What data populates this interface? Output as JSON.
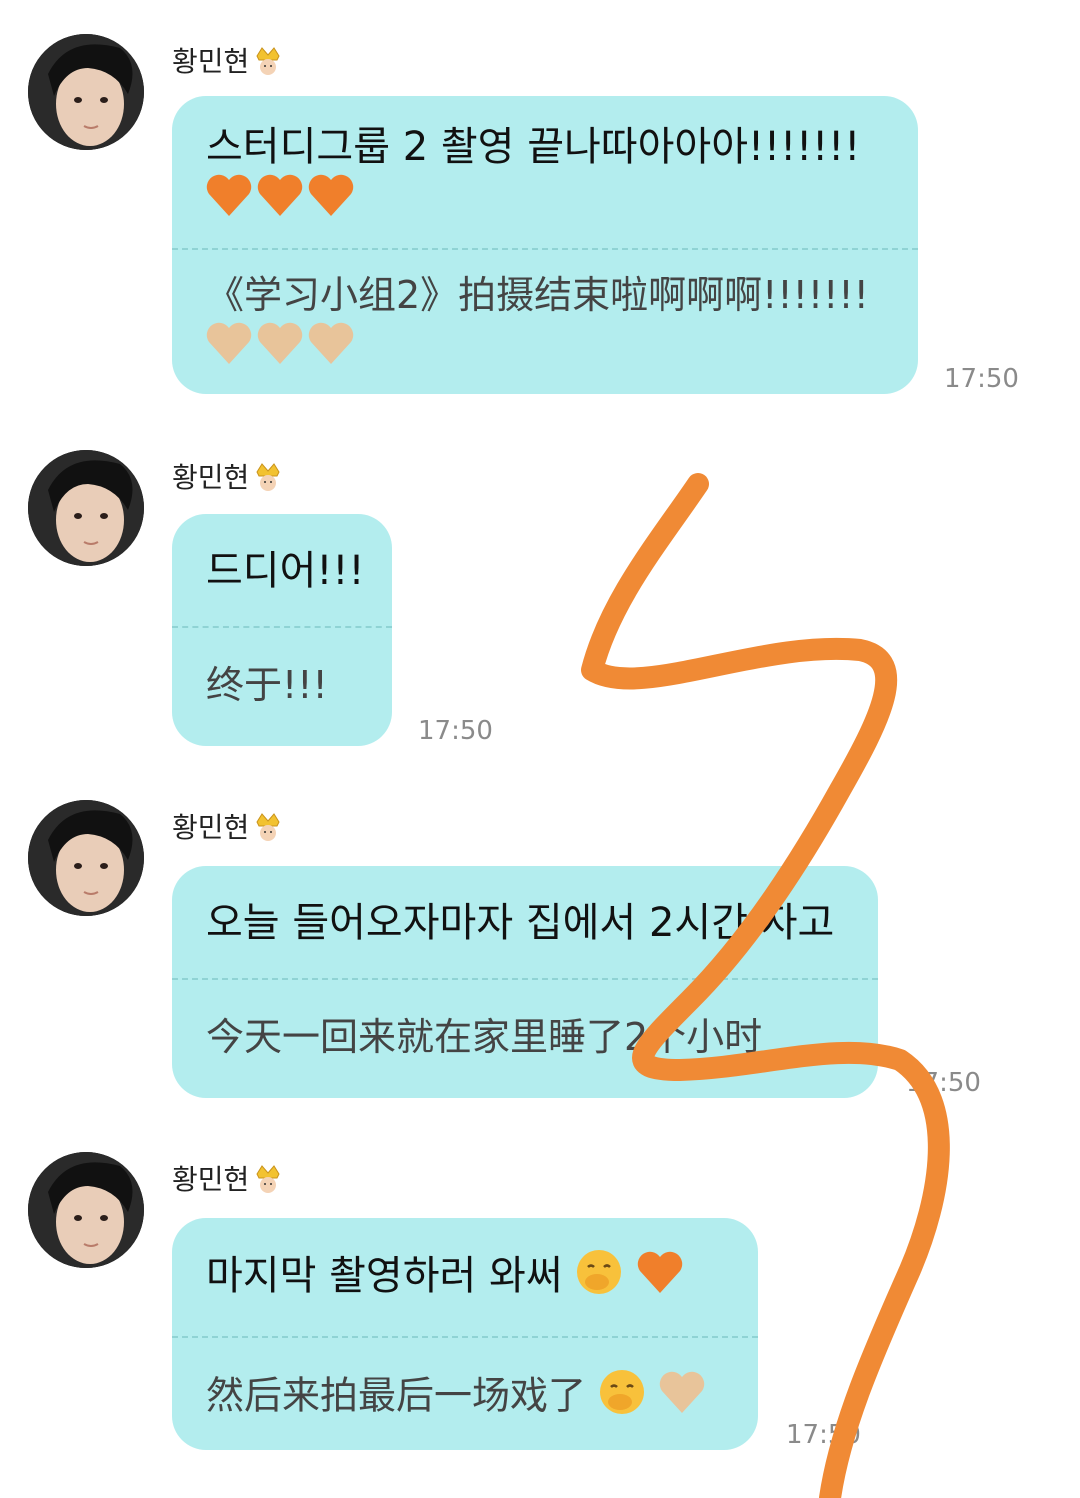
{
  "messages": [
    {
      "sender": "황민현",
      "ko": "스터디그룹 2 촬영 끝나따아아아!!!!!!!",
      "zh": "《学习小组2》拍摄结束啦啊啊啊!!!!!!!",
      "time": "17:50"
    },
    {
      "sender": "황민현",
      "ko": "드디어!!!",
      "zh": "终于!!!",
      "time": "17:50"
    },
    {
      "sender": "황민현",
      "ko": "오늘 들어오자마자 집에서 2시간 자고",
      "zh": "今天一回来就在家里睡了2个小时",
      "time": "17:50"
    },
    {
      "sender": "황민현",
      "ko": "마지막 촬영하러 와써",
      "zh": "然后来拍最后一场戏了",
      "time": "17:50"
    }
  ],
  "colors": {
    "bubble": "#b3edee",
    "heart_orange": "#f07f2b",
    "heart_beige": "#e8c49a",
    "doodle": "#f08a35"
  },
  "icons": [
    "avatar",
    "crown-icon",
    "orange-heart-icon",
    "beige-heart-icon",
    "hand-over-mouth-face-icon"
  ]
}
